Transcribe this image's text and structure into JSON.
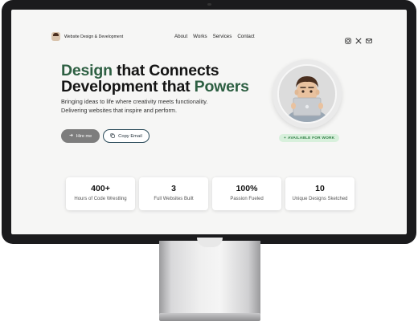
{
  "nav": {
    "brand": "Website Design & Development",
    "links": [
      "About",
      "Works",
      "Services",
      "Contact"
    ],
    "social_icons": [
      "instagram-icon",
      "x-icon",
      "mail-icon"
    ]
  },
  "hero": {
    "line1_accent": "Design",
    "line1_rest": " that Connects",
    "line2_start": "Development that ",
    "line2_accent": "Powers",
    "subtitle_line1": "Bringing ideas to life where creativity meets functionality.",
    "subtitle_line2": "Delivering websites that inspire and perform.",
    "hire_label": "Hire me",
    "copy_label": "Copy Email"
  },
  "availability": "AVAILABLE FOR WORK",
  "stats": [
    {
      "value": "400+",
      "label": "Hours of Code Wrestling"
    },
    {
      "value": "3",
      "label": "Full Websites Built"
    },
    {
      "value": "100%",
      "label": "Passion Fueled"
    },
    {
      "value": "10",
      "label": "Unique Designs Sketched"
    }
  ],
  "colors": {
    "accent": "#2d5f42",
    "badge_bg": "#d8f0dc",
    "badge_text": "#2e7d43",
    "hire_button": "#7d7d7d"
  }
}
